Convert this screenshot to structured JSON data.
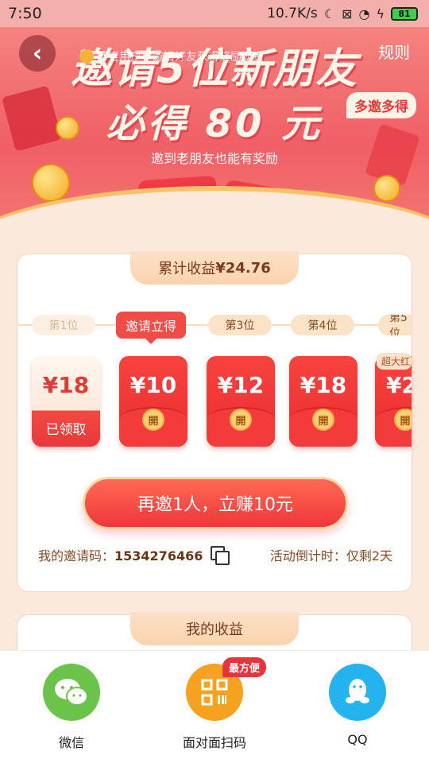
{
  "status_bar": {
    "time": "7:50",
    "speed": "10.7K/s",
    "battery": "81"
  },
  "hero": {
    "back_icon": "chevron-left-icon",
    "rules": "规则",
    "ticker": "恭喜用户**邀请好友获得奖励现金",
    "title_line1": "邀请5位新朋友",
    "title_line2": "必得 80 元",
    "badge": "多邀多得",
    "subtitle": "邀到老朋友也能有奖励"
  },
  "progress_card": {
    "tab_label": "累计收益",
    "total": "¥24.76",
    "steps": [
      {
        "label": "第1位",
        "state": "done"
      },
      {
        "label": "邀请立得",
        "state": "active"
      },
      {
        "label": "第3位",
        "state": "pending"
      },
      {
        "label": "第4位",
        "state": "pending"
      },
      {
        "label": "第5位",
        "state": "pending"
      }
    ],
    "envelopes": [
      {
        "amount": "¥18",
        "state": "claimed",
        "status_text": "已领取"
      },
      {
        "amount": "¥10",
        "state": "open",
        "seal": "開"
      },
      {
        "amount": "¥12",
        "state": "open",
        "seal": "開"
      },
      {
        "amount": "¥18",
        "state": "open",
        "seal": "開"
      },
      {
        "amount": "¥2",
        "state": "open",
        "seal": "開"
      }
    ],
    "bonus_badge": "超大红",
    "cta": "再邀1人，立赚10元",
    "invite_code_label": "我的邀请码：",
    "invite_code": "1534276466",
    "countdown": "活动倒计时：仅剩2天"
  },
  "earnings_card": {
    "tab_label": "我的收益"
  },
  "share": {
    "items": [
      {
        "label": "微信",
        "icon": "wechat-icon"
      },
      {
        "label": "面对面扫码",
        "icon": "qr-scan-icon"
      },
      {
        "label": "QQ",
        "icon": "qq-penguin-icon"
      }
    ],
    "badge": "最方便"
  },
  "colors": {
    "primary_red": "#f04b45",
    "background": "#fbe9dc",
    "gold": "#f7c26a"
  }
}
